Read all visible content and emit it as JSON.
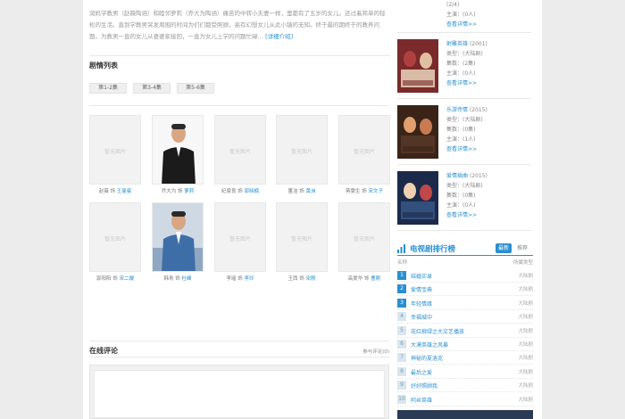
{
  "intro": {
    "text": "润妈学教男（赵薇陶涵）和睦邻萝莉（乔大为陶涵）痛苦的中转小夫妻一样，里都有了五岁的女儿。还过着简单的轻松的生活。直到学教男突发周围的时间为们们都受照顾，高有幻想女儿从此小镇的无知。终于最的期终于的教养问题。为教男一直的女儿从婆婆家接回，一直为女儿上学的问题忙碌…",
    "more": "[详细介绍]"
  },
  "episode_list": {
    "title": "剧情列表",
    "buttons": [
      "第1-2集",
      "第3-4集",
      "第5-6集"
    ]
  },
  "cast": {
    "placeholder": "暂无图片",
    "sep": "饰",
    "rows": [
      [
        {
          "actor": "赵薇",
          "role": "王曼曼",
          "photo": false
        },
        {
          "actor": "乔大为",
          "role": "萝莉",
          "photo": true
        },
        {
          "actor": "纪梁良",
          "role": "郭晓楠",
          "photo": false
        },
        {
          "actor": "董洁",
          "role": "黄洲",
          "photo": false
        },
        {
          "actor": "蒋雯生",
          "role": "宋文子",
          "photo": false
        }
      ],
      [
        {
          "actor": "郭阳阳",
          "role": "宋二嫂",
          "photo": false
        },
        {
          "actor": "韩青",
          "role": "杜峰",
          "photo": true
        },
        {
          "actor": "李瑶",
          "role": "李玲",
          "photo": false
        },
        {
          "actor": "王西",
          "role": "宋刚",
          "photo": false
        },
        {
          "actor": "高爱华",
          "role": "曹刚",
          "photo": false
        }
      ]
    ]
  },
  "comments": {
    "title": "在线评论",
    "link": "参与评论(0)"
  },
  "sidebar": {
    "top_partial": {
      "lines": [
        "(2/4)",
        "主演：(0人)",
        "查看详情>>"
      ]
    },
    "dramas": [
      {
        "title": "射雕英雄",
        "year": "(2001)",
        "l1": "(大陆剧)",
        "l2": "(2集)",
        "l3": "(0人)",
        "more": "查看详情>>"
      },
      {
        "title": "乐游传情",
        "year": "(2015)",
        "l1": "(大陆剧)",
        "l2": "(0集)",
        "l3": "(1人)",
        "more": "查看详情>>"
      },
      {
        "title": "爱情插曲",
        "year": "(2015)",
        "l1": "(大陆剧)",
        "l2": "(0集)",
        "l3": "(0人)",
        "more": "查看详情>>"
      }
    ],
    "labels": {
      "genre": "类型：",
      "eps": "集数：",
      "cast": "主演："
    },
    "rank": {
      "title": "电视剧排行榜",
      "tab_active": "最新",
      "tab_other": "推荐",
      "col_left": "名称",
      "col_right": "所属类型",
      "items": [
        {
          "num": "1",
          "name": "结婚实录",
          "cat": "大陆剧"
        },
        {
          "num": "2",
          "name": "爱情宝典",
          "cat": "大陆剧"
        },
        {
          "num": "3",
          "name": "年轻情缘",
          "cat": "大陆剧"
        },
        {
          "num": "4",
          "name": "幸福城中",
          "cat": "大陆剧"
        },
        {
          "num": "5",
          "name": "花红柳绿之大文艺播放",
          "cat": "大陆剧"
        },
        {
          "num": "6",
          "name": "大漠英雄之风暴",
          "cat": "大陆剧"
        },
        {
          "num": "7",
          "name": "神秘的夏洛克",
          "cat": "大陆剧"
        },
        {
          "num": "8",
          "name": "最后之爱",
          "cat": "大陆剧"
        },
        {
          "num": "9",
          "name": "好好照顾我",
          "cat": "大陆剧"
        },
        {
          "num": "10",
          "name": "阿丝英雄",
          "cat": "大陆剧"
        }
      ]
    }
  },
  "colors": {
    "accent": "#2a8fcf",
    "rank_top": "#2a8fcf",
    "rank_other": "#d8e6f0"
  }
}
